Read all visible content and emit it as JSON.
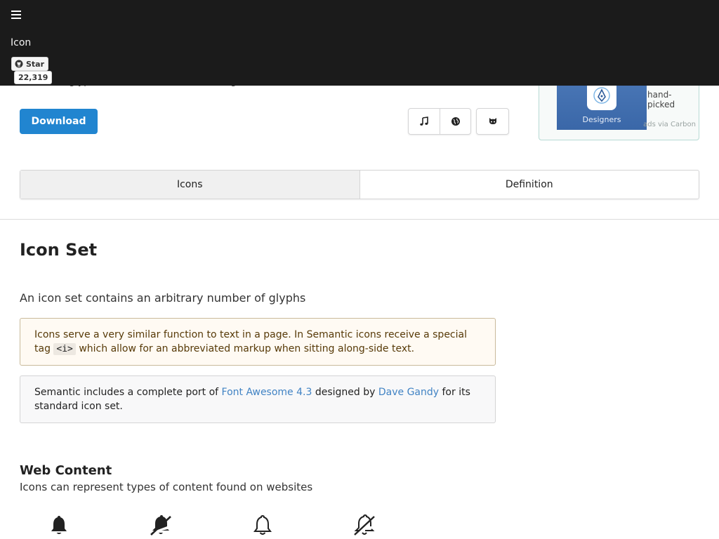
{
  "topbar": {
    "menu_icon": "hamburger-icon",
    "title": "Icon",
    "github_star": {
      "label": "Star",
      "count": "22,319",
      "icon": "github-icon"
    }
  },
  "masthead": {
    "subline": "Semantic glyphs for use with text and navigation",
    "download_label": "Download",
    "button_group_icons": [
      "music-icon",
      "globe-icon"
    ],
    "github_button_icon": "github-alt-icon",
    "ad": {
      "image_caption": "Designers",
      "text": "hand-picked",
      "via": "ads via Carbon"
    }
  },
  "tabs": [
    {
      "label": "Icons",
      "active": true
    },
    {
      "label": "Definition",
      "active": false
    }
  ],
  "main": {
    "heading": "Icon Set",
    "description": "An icon set contains an arbitrary number of glyphs",
    "warning_message": {
      "text_before": "Icons serve a very similar function to text in a page. In Semantic icons receive a special tag ",
      "code": "<i>",
      "text_after": " which allow for an abbreviated markup when sitting along-side text."
    },
    "info_message": {
      "text_before": "Semantic includes a complete port of ",
      "link1": "Font Awesome 4.3",
      "text_middle": " designed by ",
      "link2": "Dave Gandy",
      "text_after": " for its standard icon set."
    },
    "section": {
      "title": "Web Content",
      "subtitle": "Icons can represent types of content found on websites",
      "icons": [
        "alarm-icon",
        "alarm-slash-icon",
        "alarm-outline-icon",
        "alarm-slash-outline-icon"
      ]
    }
  },
  "colors": {
    "topbar_bg": "#1b1b1b",
    "primary": "#2185d0",
    "link": "#4183c4",
    "warning_bg": "#fffaf3",
    "warning_text": "#573a08",
    "info_bg": "#f8f8f9",
    "active_tab_bg": "#f0f0f0"
  }
}
